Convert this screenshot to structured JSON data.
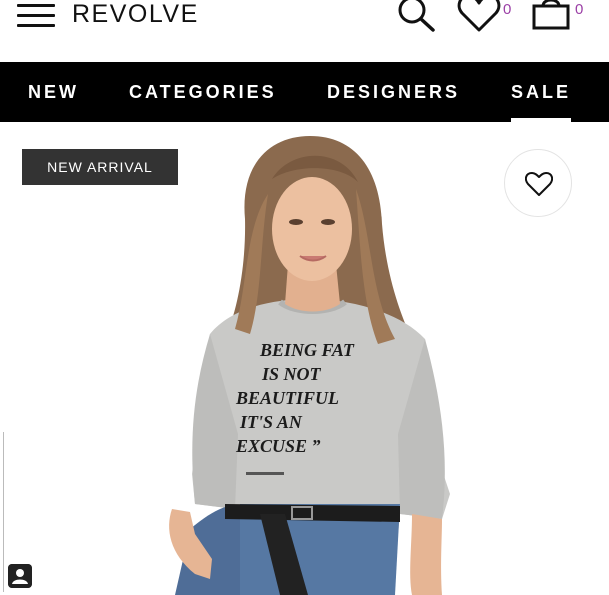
{
  "header": {
    "brand": "REVOLVE",
    "wishlist_count": "0",
    "bag_count": "0"
  },
  "nav": {
    "items": [
      {
        "label": "NEW"
      },
      {
        "label": "CATEGORIES"
      },
      {
        "label": "DESIGNERS"
      },
      {
        "label": "SALE",
        "active": true
      }
    ]
  },
  "product": {
    "badge": "NEW ARRIVAL",
    "shirt_print_lines": [
      "BEING FAT",
      "IS NOT",
      "BEAUTIFUL",
      "IT'S AN",
      "EXCUSE ”"
    ]
  },
  "icons": {
    "menu": "hamburger-menu-icon",
    "search": "search-icon",
    "wishlist": "heart-icon",
    "bag": "shopping-bag-icon",
    "favorite": "heart-icon",
    "profile": "user-icon"
  },
  "colors": {
    "nav_background": "#000000",
    "badge_background": "#333333",
    "count_color": "#9b3fa6"
  }
}
